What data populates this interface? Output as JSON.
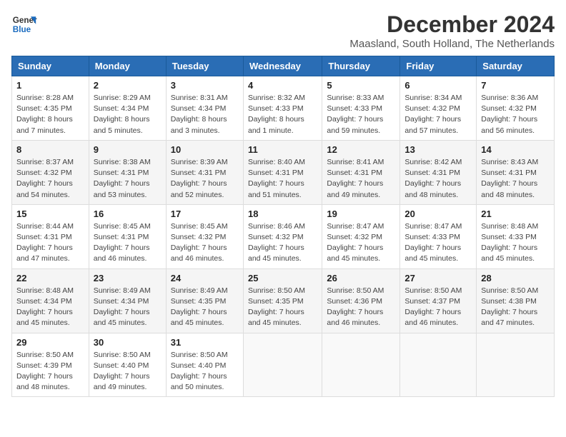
{
  "logo": {
    "line1": "General",
    "line2": "Blue"
  },
  "title": "December 2024",
  "subtitle": "Maasland, South Holland, The Netherlands",
  "days_of_week": [
    "Sunday",
    "Monday",
    "Tuesday",
    "Wednesday",
    "Thursday",
    "Friday",
    "Saturday"
  ],
  "weeks": [
    [
      {
        "day": "1",
        "sunrise": "8:28 AM",
        "sunset": "4:35 PM",
        "daylight": "8 hours and 7 minutes."
      },
      {
        "day": "2",
        "sunrise": "8:29 AM",
        "sunset": "4:34 PM",
        "daylight": "8 hours and 5 minutes."
      },
      {
        "day": "3",
        "sunrise": "8:31 AM",
        "sunset": "4:34 PM",
        "daylight": "8 hours and 3 minutes."
      },
      {
        "day": "4",
        "sunrise": "8:32 AM",
        "sunset": "4:33 PM",
        "daylight": "8 hours and 1 minute."
      },
      {
        "day": "5",
        "sunrise": "8:33 AM",
        "sunset": "4:33 PM",
        "daylight": "7 hours and 59 minutes."
      },
      {
        "day": "6",
        "sunrise": "8:34 AM",
        "sunset": "4:32 PM",
        "daylight": "7 hours and 57 minutes."
      },
      {
        "day": "7",
        "sunrise": "8:36 AM",
        "sunset": "4:32 PM",
        "daylight": "7 hours and 56 minutes."
      }
    ],
    [
      {
        "day": "8",
        "sunrise": "8:37 AM",
        "sunset": "4:32 PM",
        "daylight": "7 hours and 54 minutes."
      },
      {
        "day": "9",
        "sunrise": "8:38 AM",
        "sunset": "4:31 PM",
        "daylight": "7 hours and 53 minutes."
      },
      {
        "day": "10",
        "sunrise": "8:39 AM",
        "sunset": "4:31 PM",
        "daylight": "7 hours and 52 minutes."
      },
      {
        "day": "11",
        "sunrise": "8:40 AM",
        "sunset": "4:31 PM",
        "daylight": "7 hours and 51 minutes."
      },
      {
        "day": "12",
        "sunrise": "8:41 AM",
        "sunset": "4:31 PM",
        "daylight": "7 hours and 49 minutes."
      },
      {
        "day": "13",
        "sunrise": "8:42 AM",
        "sunset": "4:31 PM",
        "daylight": "7 hours and 48 minutes."
      },
      {
        "day": "14",
        "sunrise": "8:43 AM",
        "sunset": "4:31 PM",
        "daylight": "7 hours and 48 minutes."
      }
    ],
    [
      {
        "day": "15",
        "sunrise": "8:44 AM",
        "sunset": "4:31 PM",
        "daylight": "7 hours and 47 minutes."
      },
      {
        "day": "16",
        "sunrise": "8:45 AM",
        "sunset": "4:31 PM",
        "daylight": "7 hours and 46 minutes."
      },
      {
        "day": "17",
        "sunrise": "8:45 AM",
        "sunset": "4:32 PM",
        "daylight": "7 hours and 46 minutes."
      },
      {
        "day": "18",
        "sunrise": "8:46 AM",
        "sunset": "4:32 PM",
        "daylight": "7 hours and 45 minutes."
      },
      {
        "day": "19",
        "sunrise": "8:47 AM",
        "sunset": "4:32 PM",
        "daylight": "7 hours and 45 minutes."
      },
      {
        "day": "20",
        "sunrise": "8:47 AM",
        "sunset": "4:33 PM",
        "daylight": "7 hours and 45 minutes."
      },
      {
        "day": "21",
        "sunrise": "8:48 AM",
        "sunset": "4:33 PM",
        "daylight": "7 hours and 45 minutes."
      }
    ],
    [
      {
        "day": "22",
        "sunrise": "8:48 AM",
        "sunset": "4:34 PM",
        "daylight": "7 hours and 45 minutes."
      },
      {
        "day": "23",
        "sunrise": "8:49 AM",
        "sunset": "4:34 PM",
        "daylight": "7 hours and 45 minutes."
      },
      {
        "day": "24",
        "sunrise": "8:49 AM",
        "sunset": "4:35 PM",
        "daylight": "7 hours and 45 minutes."
      },
      {
        "day": "25",
        "sunrise": "8:50 AM",
        "sunset": "4:35 PM",
        "daylight": "7 hours and 45 minutes."
      },
      {
        "day": "26",
        "sunrise": "8:50 AM",
        "sunset": "4:36 PM",
        "daylight": "7 hours and 46 minutes."
      },
      {
        "day": "27",
        "sunrise": "8:50 AM",
        "sunset": "4:37 PM",
        "daylight": "7 hours and 46 minutes."
      },
      {
        "day": "28",
        "sunrise": "8:50 AM",
        "sunset": "4:38 PM",
        "daylight": "7 hours and 47 minutes."
      }
    ],
    [
      {
        "day": "29",
        "sunrise": "8:50 AM",
        "sunset": "4:39 PM",
        "daylight": "7 hours and 48 minutes."
      },
      {
        "day": "30",
        "sunrise": "8:50 AM",
        "sunset": "4:40 PM",
        "daylight": "7 hours and 49 minutes."
      },
      {
        "day": "31",
        "sunrise": "8:50 AM",
        "sunset": "4:40 PM",
        "daylight": "7 hours and 50 minutes."
      },
      null,
      null,
      null,
      null
    ]
  ]
}
